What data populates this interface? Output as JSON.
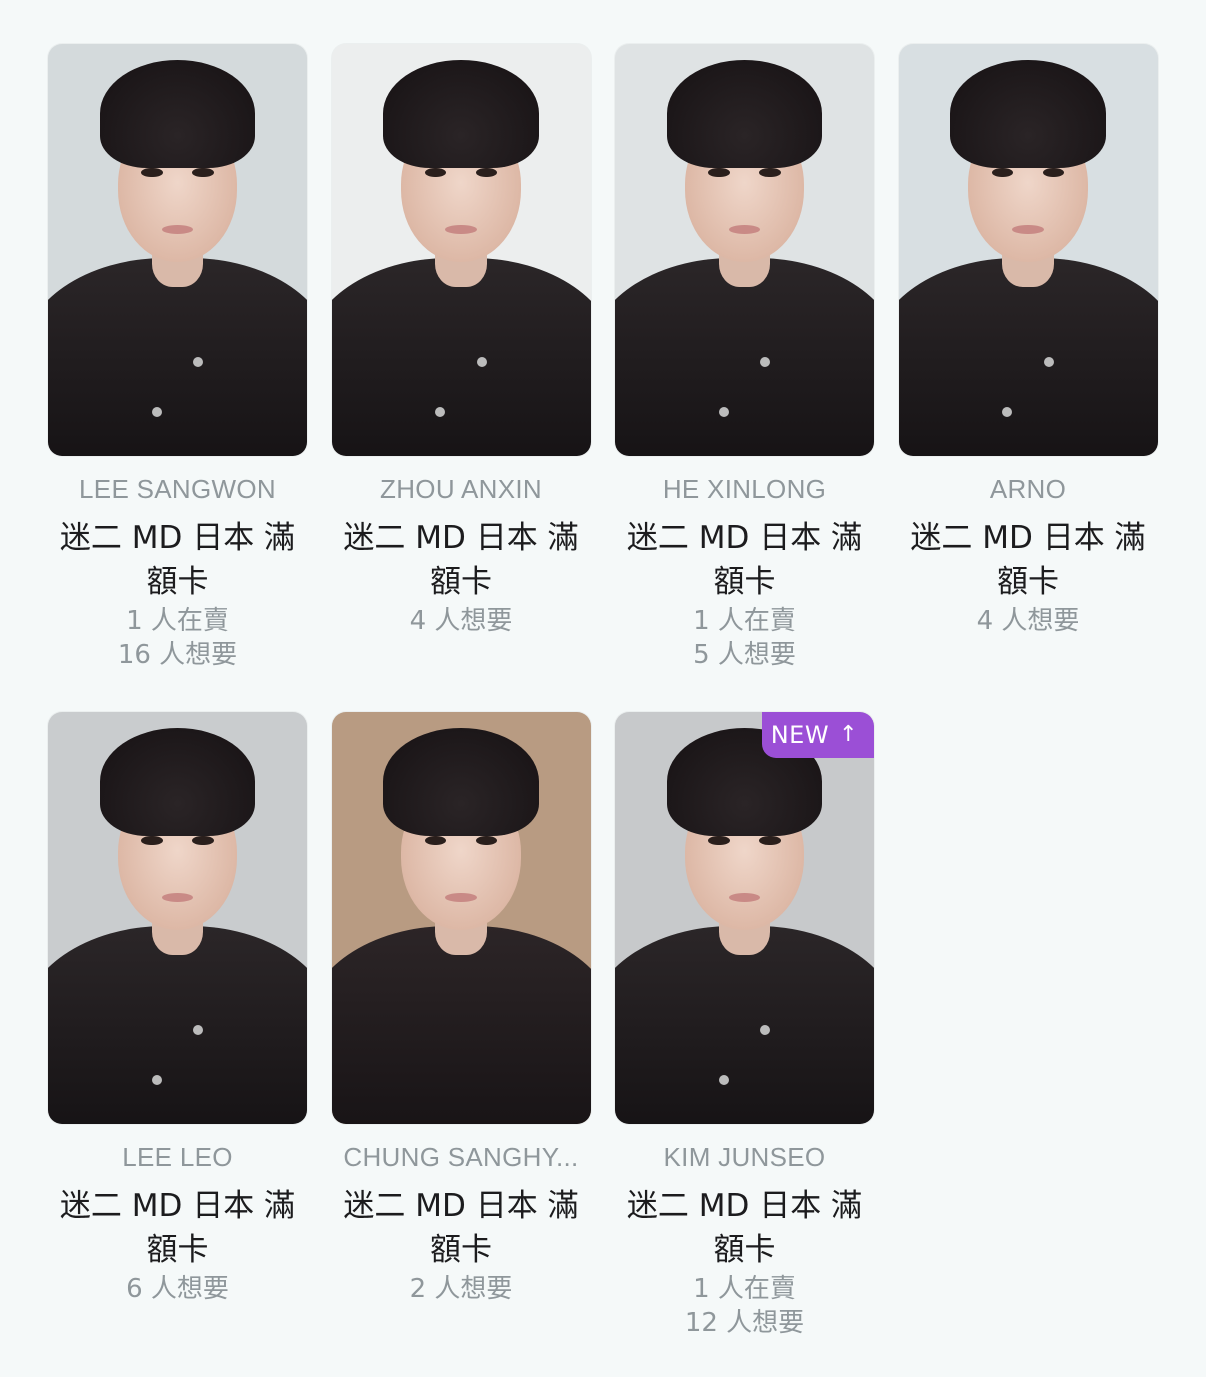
{
  "cards": [
    {
      "member": "LEE SANGWON",
      "title": "迷二 MD 日本 滿額卡",
      "stats": [
        "1 人在賣",
        "16 人想要"
      ],
      "bg": "#d4dadc"
    },
    {
      "member": "ZHOU ANXIN",
      "title": "迷二 MD 日本 滿額卡",
      "stats": [
        "4 人想要"
      ],
      "bg": "#eceeee"
    },
    {
      "member": "HE XINLONG",
      "title": "迷二 MD 日本 滿額卡",
      "stats": [
        "1 人在賣",
        "5 人想要"
      ],
      "bg": "#dfe3e4"
    },
    {
      "member": "ARNO",
      "title": "迷二 MD 日本 滿額卡",
      "stats": [
        "4 人想要"
      ],
      "bg": "#d8dfe2"
    },
    {
      "member": "LEE LEO",
      "title": "迷二 MD 日本 滿額卡",
      "stats": [
        "6 人想要"
      ],
      "bg": "#c9ccce"
    },
    {
      "member": "CHUNG SANGHY...",
      "title": "迷二 MD 日本 滿額卡",
      "stats": [
        "2 人想要"
      ],
      "bg": "#b89b82"
    },
    {
      "member": "KIM JUNSEO",
      "title": "迷二 MD 日本 滿額卡",
      "stats": [
        "1 人在賣",
        "12 人想要"
      ],
      "bg": "#c7c9cb",
      "badge": "NEW"
    }
  ],
  "badge_arrow_icon": "arrow-up-icon",
  "colors": {
    "background": "#f5f9f9",
    "badge": "#9b4fd6",
    "muted_text": "#8f979b",
    "title_text": "#1c1c1e"
  }
}
